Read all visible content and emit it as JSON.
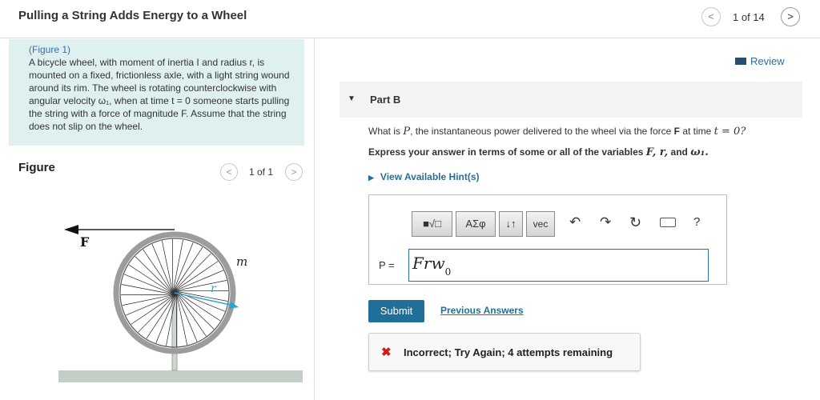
{
  "header": {
    "title": "Pulling a String Adds Energy to a Wheel",
    "prev_icon": "chevron-left-icon",
    "next_icon": "chevron-right-icon",
    "page_counter": "1 of 14"
  },
  "problem": {
    "figure_link": "(Figure 1)",
    "text": "A bicycle wheel, with moment of inertia I and radius r, is mounted on a fixed, frictionless axle, with a light string wound around its rim. The wheel is rotating counterclockwise with angular velocity ω₁, when at time t = 0 someone starts pulling the string with a force of magnitude F. Assume that the string does not slip on the wheel."
  },
  "figure": {
    "label": "Figure",
    "counter": "1 of 1",
    "force_label": "F",
    "mass_label": "m",
    "radius_label": "r"
  },
  "review": {
    "label": "Review"
  },
  "part": {
    "label": "Part B"
  },
  "question": {
    "pre": "What is ",
    "var_p": "P",
    "mid": ", the instantaneous power delivered to the wheel via the force ",
    "var_f": "F",
    "mid2": " at time ",
    "var_t": "t = 0?"
  },
  "instructions": {
    "pre": "Express your answer in terms of some or all of the variables ",
    "vars": "F, r,",
    "and": " and ",
    "omega": "ω₁."
  },
  "hint": {
    "label": "View Available Hint(s)"
  },
  "toolbar": {
    "templates": "■√□",
    "greek": "ΑΣφ",
    "arrows": "↓↑",
    "vec": "vec",
    "help": "?"
  },
  "answer": {
    "label": "P =",
    "value_main": "Frw",
    "value_sub": "0"
  },
  "actions": {
    "submit": "Submit",
    "previous_answers": "Previous Answers"
  },
  "feedback": {
    "icon": "x-icon",
    "text": "Incorrect; Try Again; 4 attempts remaining"
  },
  "colors": {
    "accent": "#1f6f99",
    "problem_bg": "#dff0f0",
    "error": "#d01b1b"
  }
}
